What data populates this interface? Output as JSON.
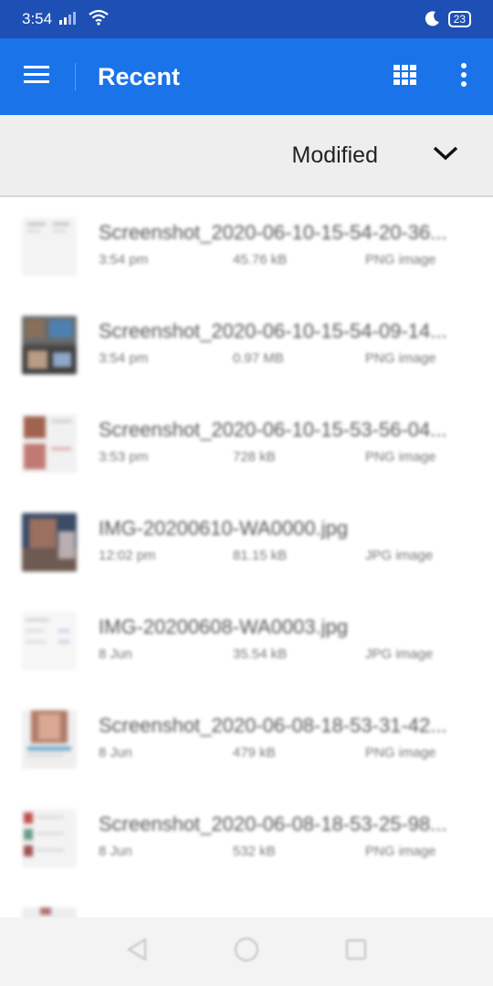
{
  "status_bar": {
    "time": "3:54",
    "battery": "23"
  },
  "app_bar": {
    "title": "Recent",
    "icons": [
      "menu-icon",
      "grid-view-icon",
      "more-vert-icon"
    ],
    "color": "#1a73e8"
  },
  "sort": {
    "label": "Modified",
    "icon": "chevron-down-icon"
  },
  "files": [
    {
      "name": "Screenshot_2020-06-10-15-54-20-36...",
      "time": "3:54 pm",
      "size": "45.76 kB",
      "type": "PNG image"
    },
    {
      "name": "Screenshot_2020-06-10-15-54-09-14...",
      "time": "3:54 pm",
      "size": "0.97 MB",
      "type": "PNG image"
    },
    {
      "name": "Screenshot_2020-06-10-15-53-56-04...",
      "time": "3:53 pm",
      "size": "728 kB",
      "type": "PNG image"
    },
    {
      "name": "IMG-20200610-WA0000.jpg",
      "time": "12:02 pm",
      "size": "81.15 kB",
      "type": "JPG image"
    },
    {
      "name": "IMG-20200608-WA0003.jpg",
      "time": "8 Jun",
      "size": "35.54 kB",
      "type": "JPG image"
    },
    {
      "name": "Screenshot_2020-06-08-18-53-31-42...",
      "time": "8 Jun",
      "size": "479 kB",
      "type": "PNG image"
    },
    {
      "name": "Screenshot_2020-06-08-18-53-25-98...",
      "time": "8 Jun",
      "size": "532 kB",
      "type": "PNG image"
    }
  ]
}
